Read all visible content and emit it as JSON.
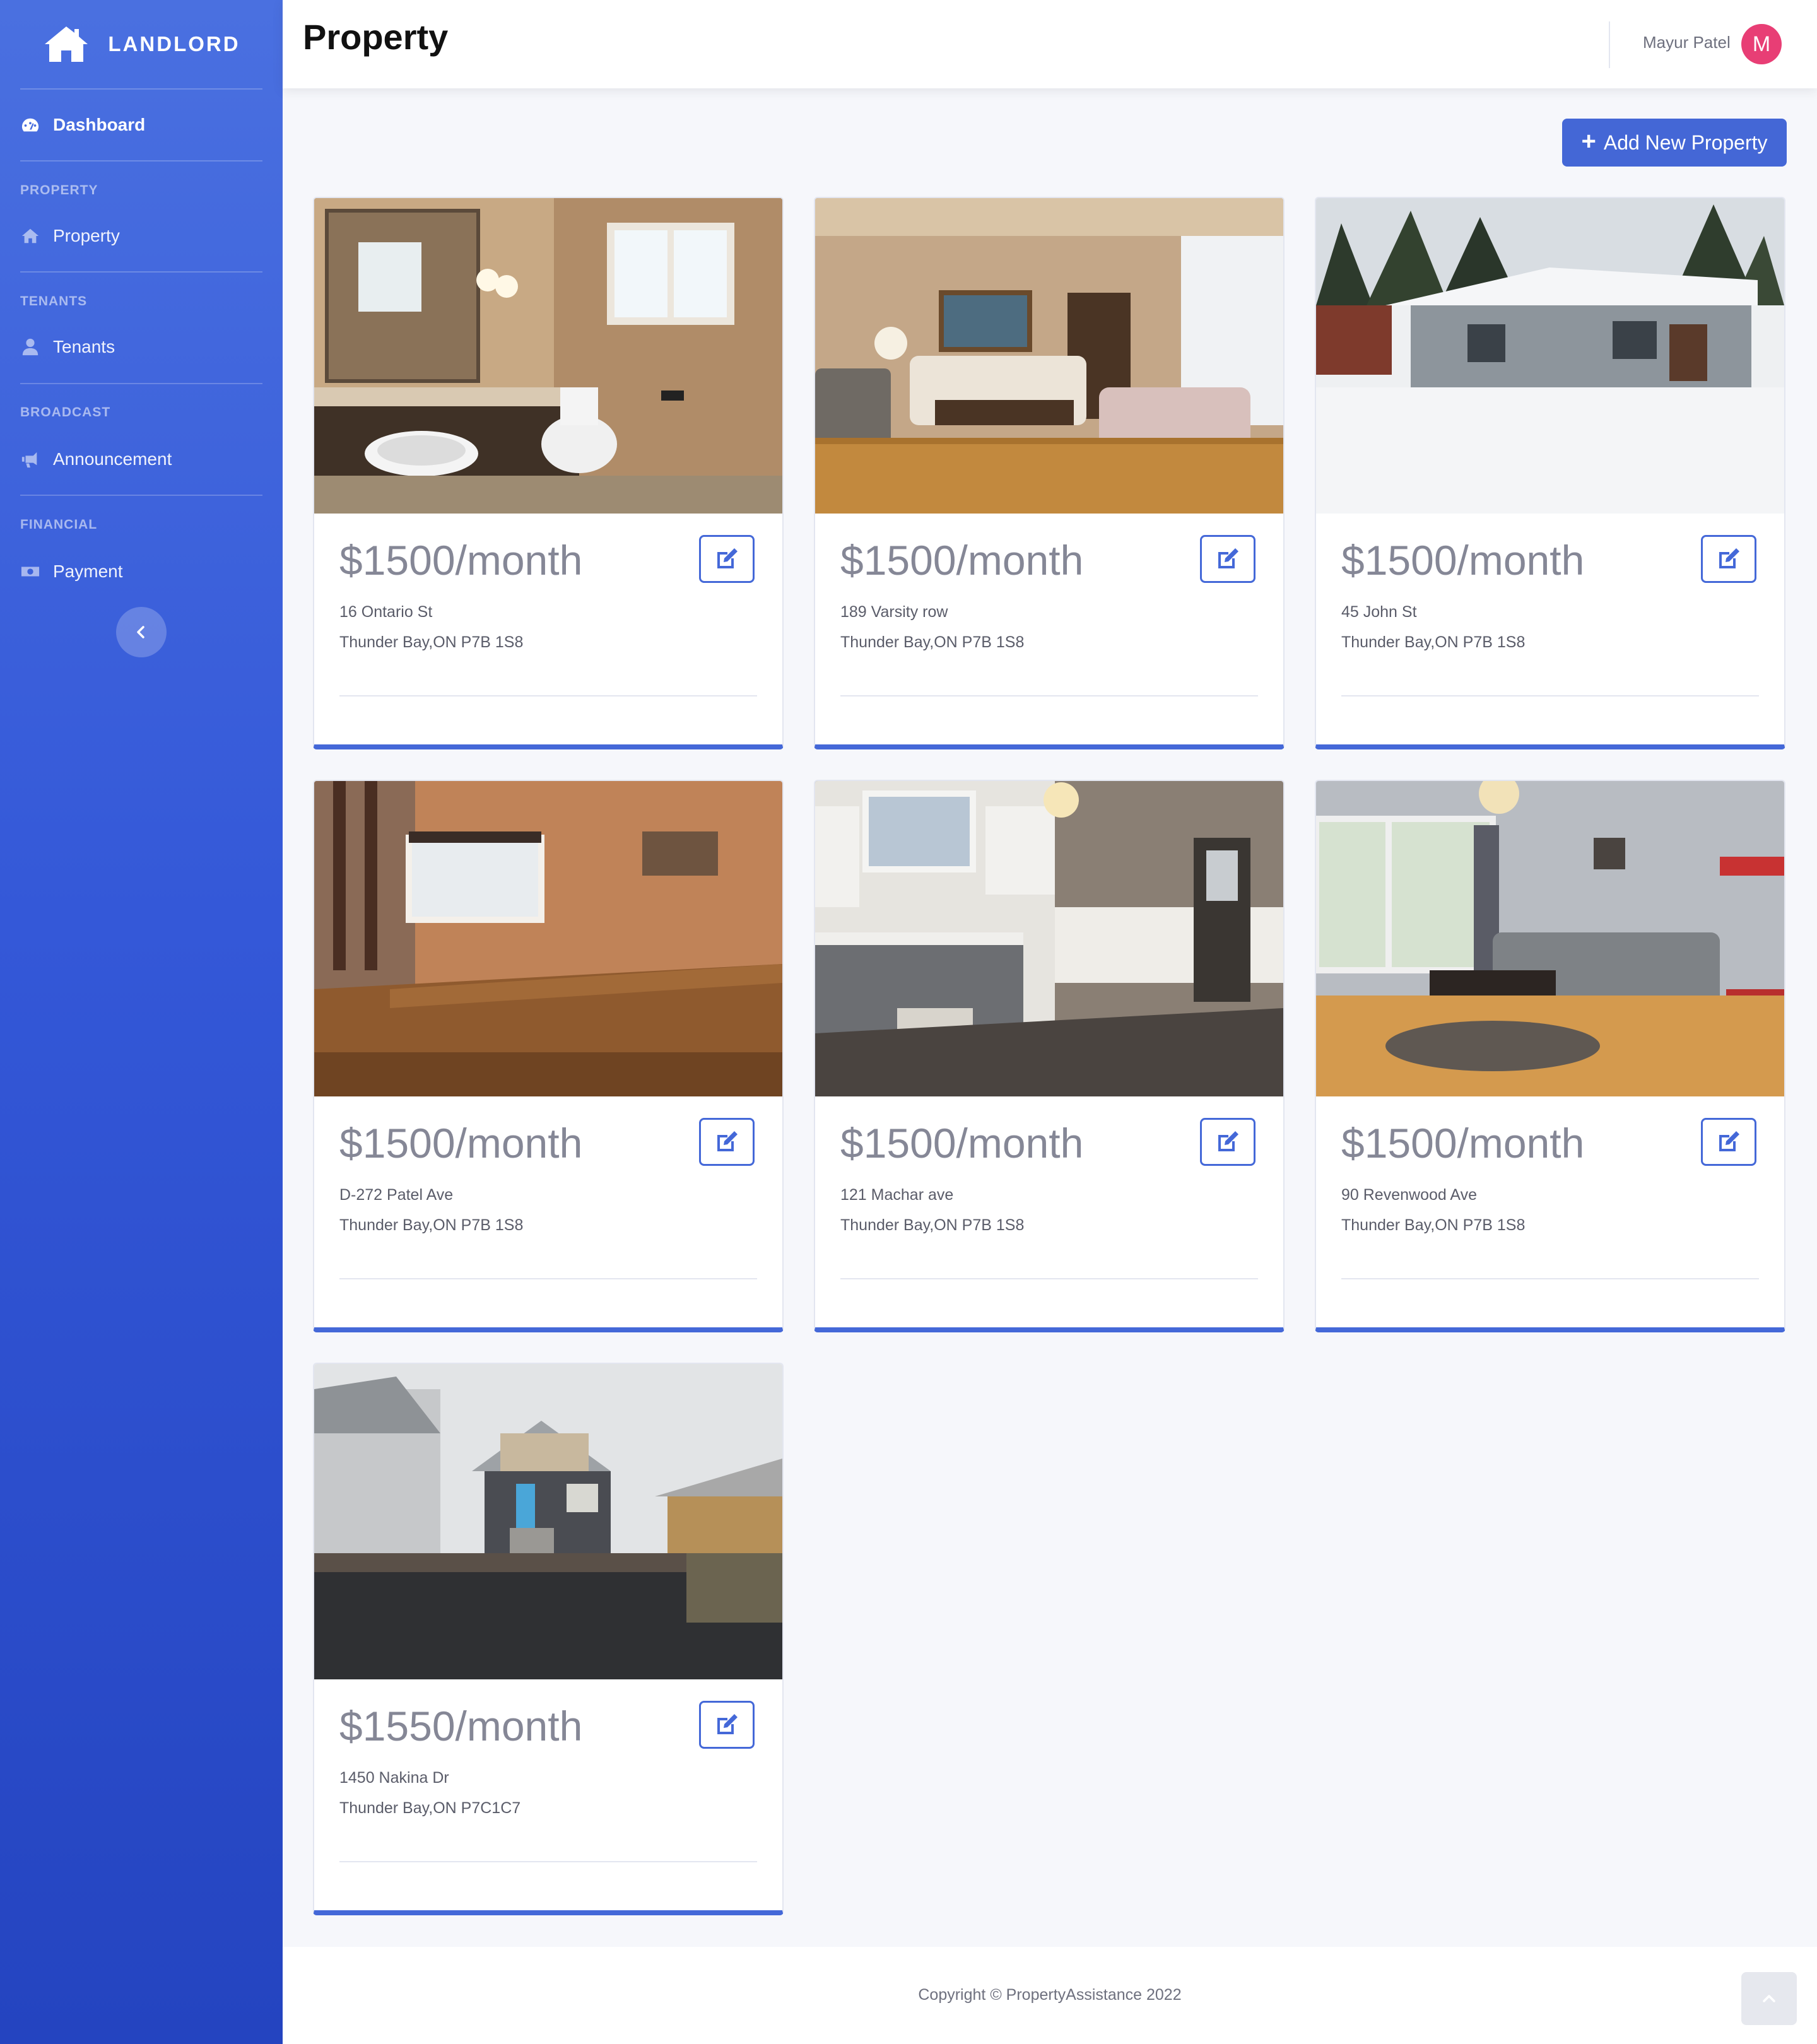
{
  "brand": {
    "name": "LANDLORD",
    "icon": "home-icon"
  },
  "sidebar": {
    "dashboard": {
      "label": "Dashboard",
      "icon": "tachometer-icon"
    },
    "sections": [
      {
        "heading": "PROPERTY",
        "item": {
          "label": "Property",
          "icon": "home-icon"
        }
      },
      {
        "heading": "TENANTS",
        "item": {
          "label": "Tenants",
          "icon": "user-icon"
        }
      },
      {
        "heading": "BROADCAST",
        "item": {
          "label": "Announcement",
          "icon": "bullhorn-icon"
        }
      },
      {
        "heading": "FINANCIAL",
        "item": {
          "label": "Payment",
          "icon": "money-bill-icon"
        }
      }
    ],
    "toggle_icon": "chevron-left-icon"
  },
  "topbar": {
    "title": "Property",
    "user_name": "Mayur Patel",
    "avatar_initial": "M"
  },
  "actions": {
    "add_property_label": "Add New Property"
  },
  "properties": [
    {
      "price": "$1500/month",
      "address_line1": "16 Ontario St",
      "address_line2": "Thunder Bay,ON P7B 1S8",
      "photo": "bathroom"
    },
    {
      "price": "$1500/month",
      "address_line1": "189 Varsity row",
      "address_line2": "Thunder Bay,ON P7B 1S8",
      "photo": "living room"
    },
    {
      "price": "$1500/month",
      "address_line1": "45 John St",
      "address_line2": "Thunder Bay,ON P7B 1S8",
      "photo": "house exterior in snow"
    },
    {
      "price": "$1500/month",
      "address_line1": "D-272 Patel Ave",
      "address_line2": "Thunder Bay,ON P7B 1S8",
      "photo": "empty room"
    },
    {
      "price": "$1500/month",
      "address_line1": "121 Machar ave",
      "address_line2": "Thunder Bay,ON P7B 1S8",
      "photo": "kitchen"
    },
    {
      "price": "$1500/month",
      "address_line1": "90 Revenwood Ave",
      "address_line2": "Thunder Bay,ON P7B 1S8",
      "photo": "living room"
    },
    {
      "price": "$1550/month",
      "address_line1": "1450 Nakina Dr",
      "address_line2": "Thunder Bay,ON P7C1C7",
      "photo": "house exterior"
    }
  ],
  "footer": {
    "copyright": "Copyright © PropertyAssistance 2022",
    "scroll_top_icon": "chevron-up-icon"
  },
  "colors": {
    "sidebar": "#3458d8",
    "accent": "#4468d8",
    "avatar": "#e83e75"
  }
}
